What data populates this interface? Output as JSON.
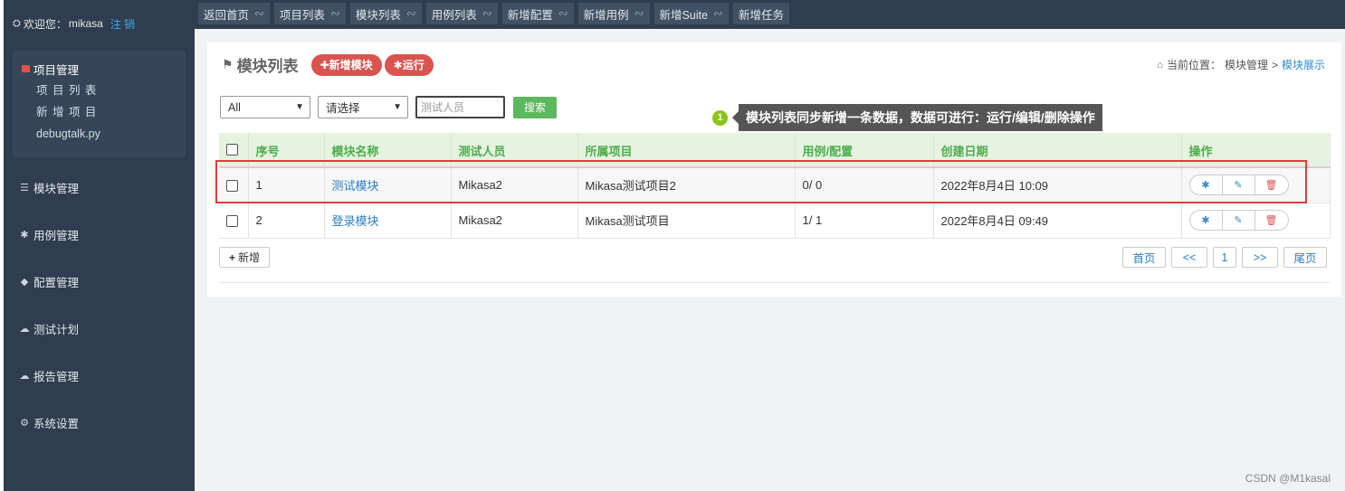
{
  "sidebar": {
    "welcome": "欢迎您：",
    "username": "mikasa",
    "logout": "注 销",
    "project_menu": {
      "title": "项目管理",
      "items": [
        "项 目 列 表",
        "新 增 项 目",
        "debugtalk.py"
      ]
    },
    "nav": [
      {
        "label": "模块管理",
        "icon": "list-icon"
      },
      {
        "label": "用例管理",
        "icon": "bug-icon"
      },
      {
        "label": "配置管理",
        "icon": "tags-icon"
      },
      {
        "label": "测试计划",
        "icon": "cloud-icon"
      },
      {
        "label": "报告管理",
        "icon": "cloud-download-icon"
      },
      {
        "label": "系统设置",
        "icon": "gears-icon"
      }
    ]
  },
  "topnav": [
    "返回首页",
    "项目列表",
    "模块列表",
    "用例列表",
    "新增配置",
    "新增用例",
    "新增Suite",
    "新增任务"
  ],
  "page": {
    "title": "模块列表",
    "add_button": "新增模块",
    "run_button": "运行",
    "breadcrumb": {
      "prefix": "当前位置：",
      "parent": "模块管理",
      "sep": ">",
      "current": "模块展示"
    }
  },
  "filters": {
    "project_select": "All",
    "user_select": "请选择",
    "tester_placeholder": "测试人员",
    "search_button": "搜索"
  },
  "tooltip": {
    "number": "1",
    "text": "模块列表同步新增一条数据，数据可进行：运行/编辑/删除操作"
  },
  "table": {
    "columns": [
      "序号",
      "模块名称",
      "测试人员",
      "所属项目",
      "用例/配置",
      "创建日期",
      "操作"
    ],
    "rows": [
      {
        "index": "1",
        "name": "测试模块",
        "tester": "Mikasa2",
        "project": "Mikasa测试项目2",
        "counts": "0/ 0",
        "created": "2022年8月4日 10:09"
      },
      {
        "index": "2",
        "name": "登录模块",
        "tester": "Mikasa2",
        "project": "Mikasa测试项目",
        "counts": "1/ 1",
        "created": "2022年8月4日 09:49"
      }
    ]
  },
  "add_row_button": "新增",
  "pagination": [
    "首页",
    "<<",
    "1",
    ">>",
    "尾页"
  ],
  "watermark": "CSDN @M1kasal",
  "colors": {
    "sidebar": "#2f3d4e",
    "danger": "#d9534f",
    "success": "#5cb85c",
    "header_green": "#4cae4c",
    "link": "#2b7fc2",
    "highlight": "#e23b3b"
  }
}
